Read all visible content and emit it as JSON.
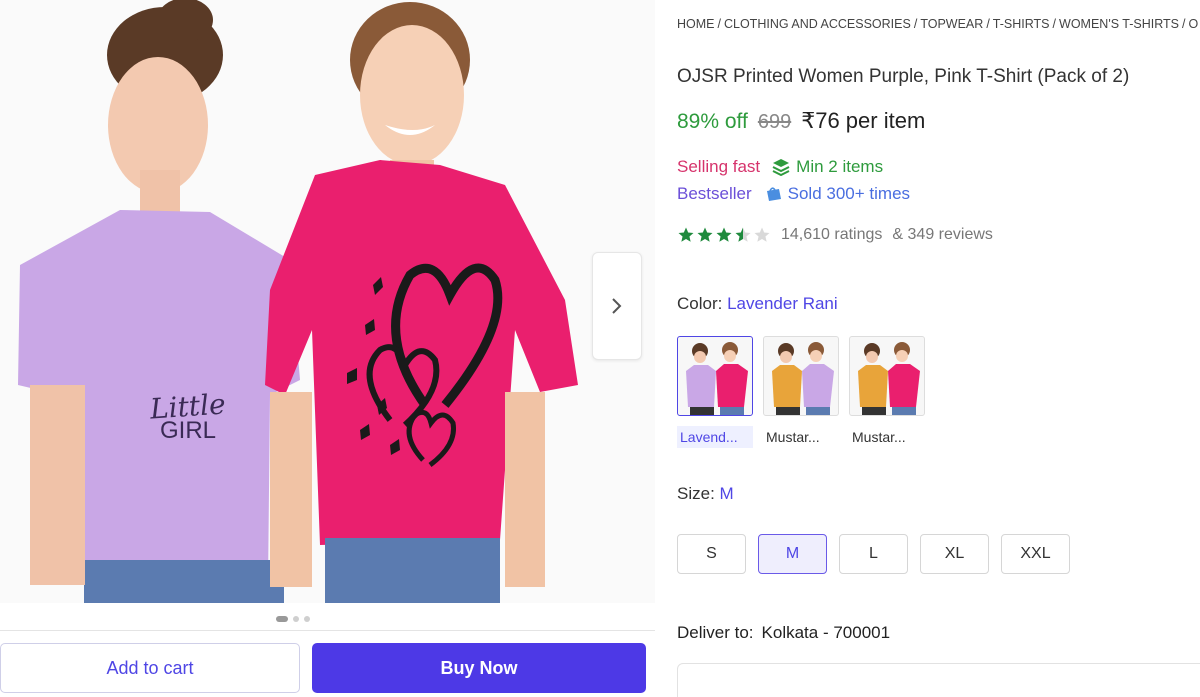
{
  "breadcrumb": [
    "HOME",
    "CLOTHING AND ACCESSORIES",
    "TOPWEAR",
    "T-SHIRTS",
    "WOMEN'S T-SHIRTS",
    "O"
  ],
  "product": {
    "title": "OJSR Printed Women Purple, Pink T-Shirt (Pack of 2)",
    "discount": "89% off",
    "mrp": "699",
    "price": "₹76 per item"
  },
  "badges": {
    "selling_fast": "Selling fast",
    "min_items": "Min 2 items",
    "bestseller": "Bestseller",
    "sold": "Sold 300+ times"
  },
  "rating": {
    "stars": 3.5,
    "max_stars": 5,
    "ratings": "14,610 ratings",
    "reviews": "& 349 reviews"
  },
  "color": {
    "label": "Color:",
    "selected": "Lavender Rani",
    "options": [
      {
        "caption": "Lavend...",
        "selected": true,
        "left": "#c9a7e6",
        "right": "#ea1f6e"
      },
      {
        "caption": "Mustar...",
        "selected": false,
        "left": "#e8a43a",
        "right": "#c9a7e6"
      },
      {
        "caption": "Mustar...",
        "selected": false,
        "left": "#e8a43a",
        "right": "#ea1f6e"
      }
    ]
  },
  "size": {
    "label": "Size:",
    "selected": "M",
    "options": [
      "S",
      "M",
      "L",
      "XL",
      "XXL"
    ]
  },
  "delivery": {
    "label": "Deliver to:",
    "location": "Kolkata - 700001"
  },
  "actions": {
    "add_to_cart": "Add to cart",
    "buy_now": "Buy Now"
  },
  "gallery": {
    "print_text_1": "Little",
    "print_text_2": "GIRL",
    "total_images": 3,
    "active_index": 0
  },
  "colors": {
    "accent": "#4d39e6",
    "discount_green": "#2e9b3d",
    "selling_fast_pink": "#d6336c",
    "bestseller_purple": "#6b4fd8",
    "sold_blue": "#4a6ee0",
    "shirt_lavender": "#c9a7e6",
    "shirt_pink": "#ea1f6e",
    "star_green": "#1f8a3d"
  }
}
